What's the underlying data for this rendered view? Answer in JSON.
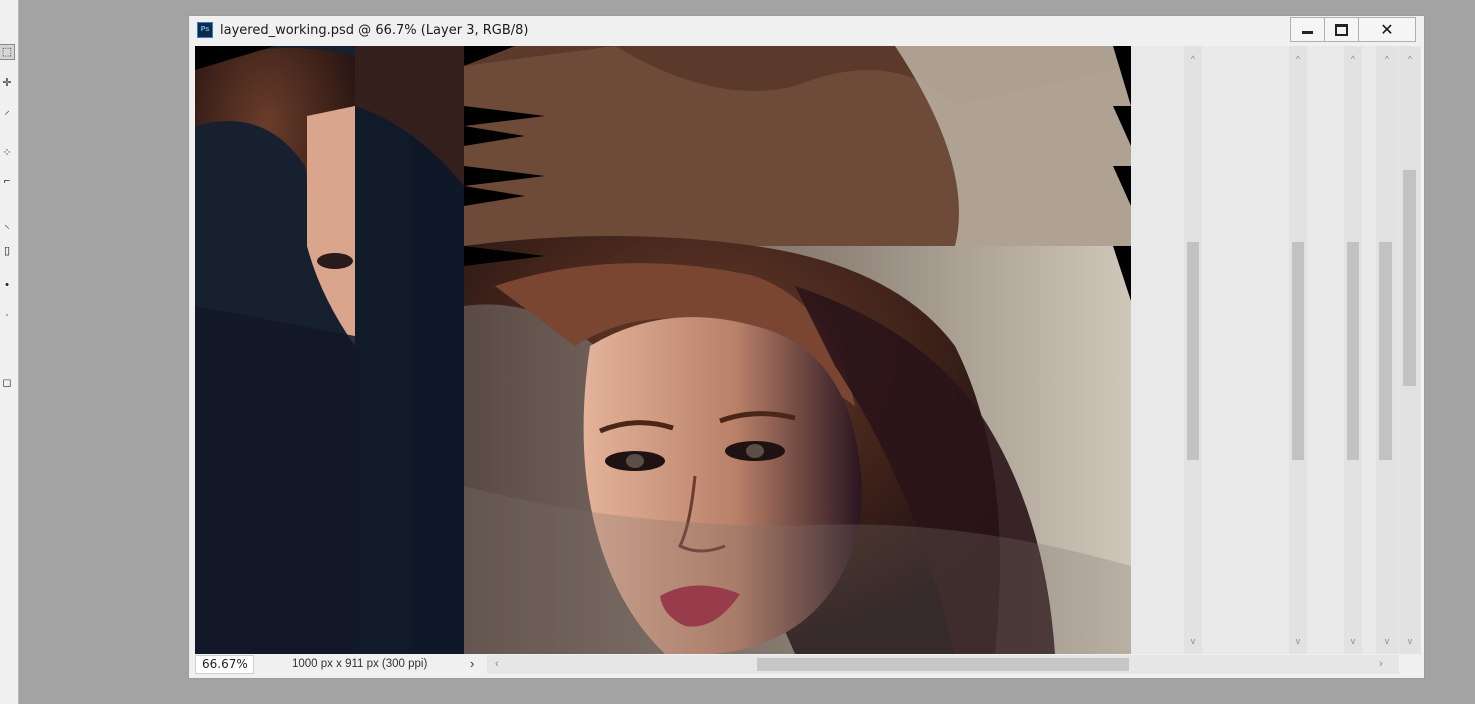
{
  "document": {
    "title": "layered_working.psd @ 66.7% (Layer 3, RGB/8)",
    "app_icon_label": "Ps"
  },
  "window_controls": {
    "minimize": "minimize-icon",
    "maximize": "maximize-icon",
    "close": "✕"
  },
  "status": {
    "zoom": "66.67%",
    "doc_info": "1000 px x 911 px (300 ppi)",
    "info_arrow": "›",
    "left_arrow": "‹",
    "right_arrow": "›"
  },
  "scroll": {
    "up": "^",
    "down": "v"
  },
  "colors": {
    "canvas_dark": "#111526",
    "hair_brown": "#4a2a1f",
    "skin": "#d9a58c",
    "background_beige": "#c9c2b2"
  }
}
